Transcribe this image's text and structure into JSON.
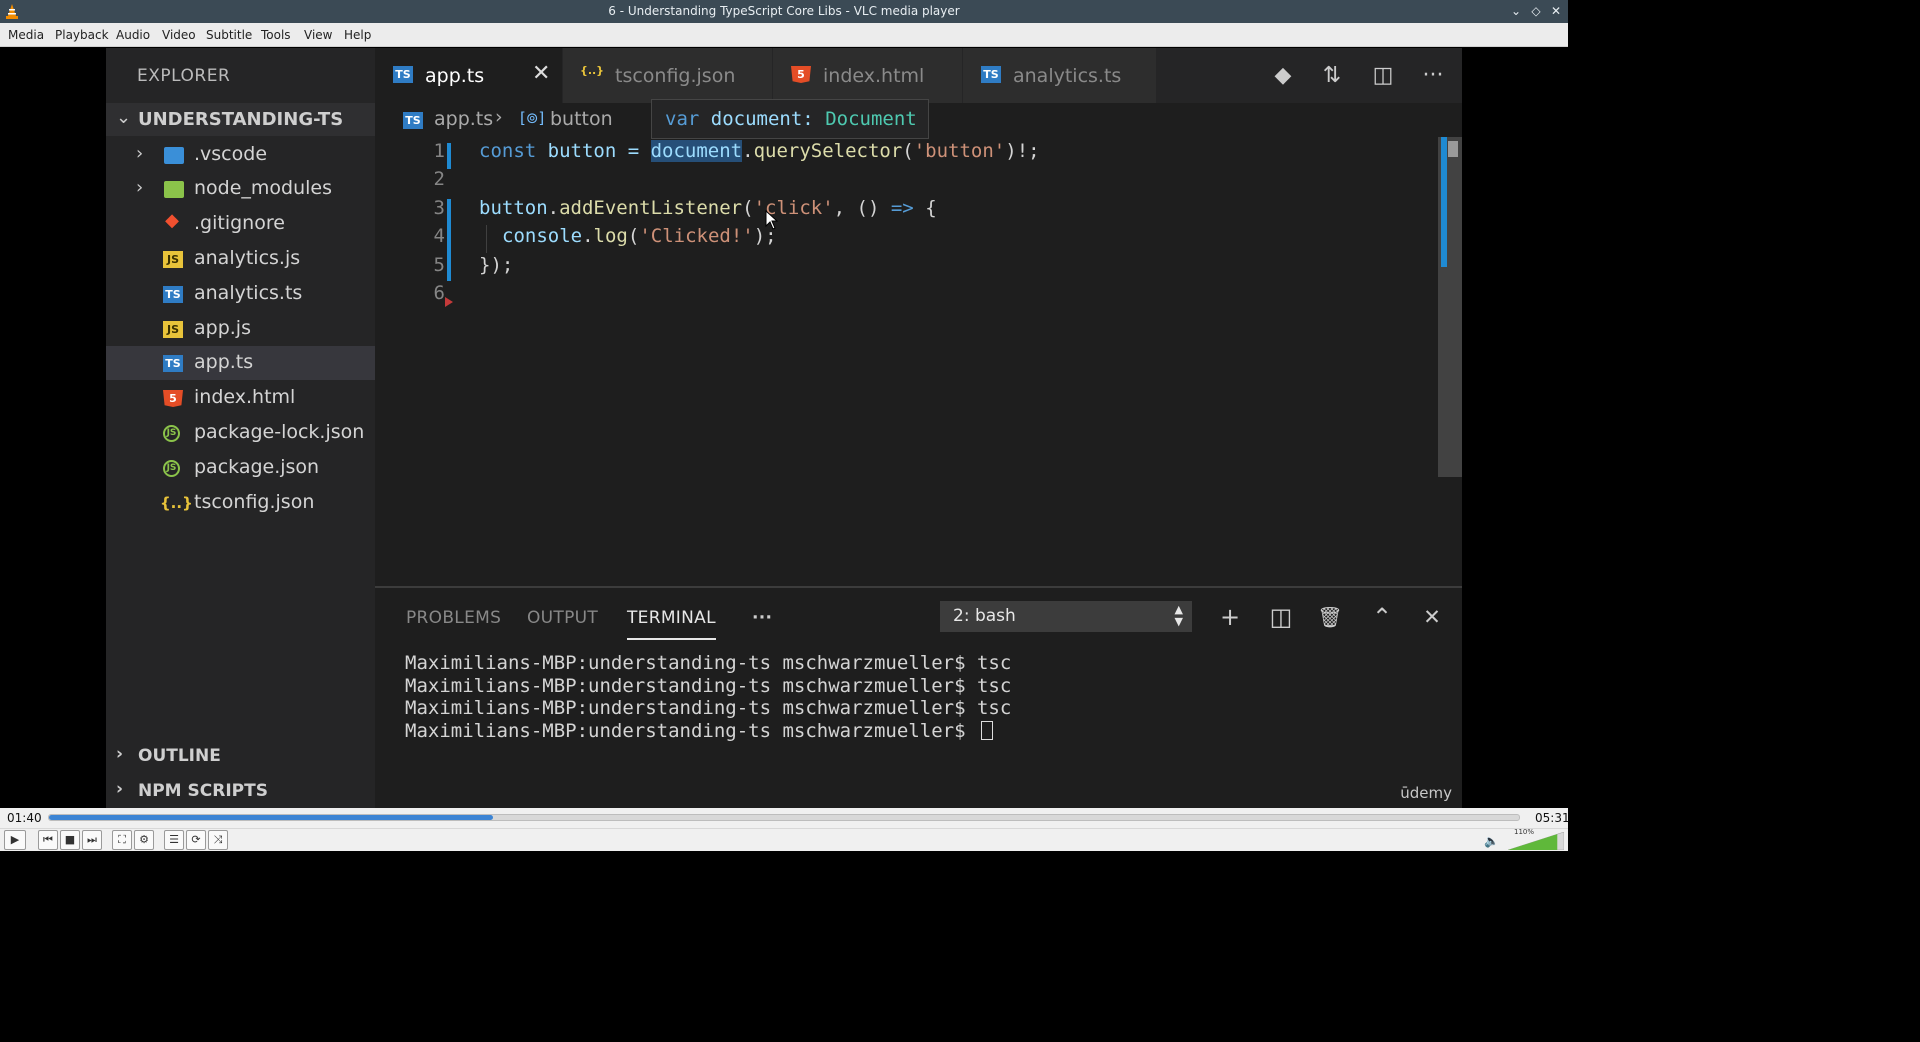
{
  "window": {
    "title": "6 - Understanding TypeScript Core Libs - VLC media player"
  },
  "menubar": [
    "Media",
    "Playback",
    "Audio",
    "Video",
    "Subtitle",
    "Tools",
    "View",
    "Help"
  ],
  "explorer": {
    "header": "EXPLORER",
    "root": "UNDERSTANDING-TS",
    "items": [
      {
        "name": ".vscode",
        "icon": "folder-vscode-icon",
        "folder": true
      },
      {
        "name": "node_modules",
        "icon": "folder-node-icon",
        "folder": true
      },
      {
        "name": ".gitignore",
        "icon": "git-icon"
      },
      {
        "name": "analytics.js",
        "icon": "js-file-icon"
      },
      {
        "name": "analytics.ts",
        "icon": "ts-file-icon"
      },
      {
        "name": "app.js",
        "icon": "js-file-icon"
      },
      {
        "name": "app.ts",
        "icon": "ts-file-icon",
        "selected": true
      },
      {
        "name": "index.html",
        "icon": "html5-file-icon"
      },
      {
        "name": "package-lock.json",
        "icon": "npm-json-icon"
      },
      {
        "name": "package.json",
        "icon": "npm-json-icon"
      },
      {
        "name": "tsconfig.json",
        "icon": "json-braces-icon"
      }
    ],
    "outline": "OUTLINE",
    "npm_scripts": "NPM SCRIPTS"
  },
  "tabs": [
    {
      "label": "app.ts",
      "active": true
    },
    {
      "label": "tsconfig.json"
    },
    {
      "label": "index.html"
    },
    {
      "label": "analytics.ts"
    }
  ],
  "breadcrumb": {
    "file": "app.ts",
    "symbol": "button"
  },
  "hover": {
    "keyword": "var",
    "name": "document:",
    "type": "Document"
  },
  "code": {
    "line_numbers": [
      "1",
      "2",
      "3",
      "4",
      "5",
      "6"
    ],
    "l1": {
      "kw": "const",
      "name": " button = ",
      "doc": "document",
      "rest_pre": ".",
      "fn": "querySelector",
      "p1": "(",
      "str": "'button'",
      "p2": ")!;"
    },
    "l3": {
      "obj": "button",
      "dot": ".",
      "fn": "addEventListener",
      "p1": "(",
      "str": "'click'",
      "p2": ", () ",
      "arrow": "=>",
      "p3": " {"
    },
    "l4": {
      "obj": "console",
      "dot": ".",
      "fn": "log",
      "p1": "(",
      "str": "'Clicked!'",
      "p2": ");"
    },
    "l5": "});"
  },
  "panel": {
    "tabs": [
      "PROBLEMS",
      "OUTPUT",
      "TERMINAL",
      "···"
    ],
    "active_tab": "TERMINAL",
    "shell_select": "2: bash",
    "terminal_lines": [
      "Maximilians-MBP:understanding-ts mschwarzmueller$ tsc",
      "Maximilians-MBP:understanding-ts mschwarzmueller$ tsc",
      "Maximilians-MBP:understanding-ts mschwarzmueller$ tsc",
      "Maximilians-MBP:understanding-ts mschwarzmueller$ "
    ],
    "watermark": "ūdemy"
  },
  "player": {
    "elapsed": "01:40",
    "total": "05:31",
    "progress": 0.302,
    "volume_label": "110%",
    "volume": 1.1
  },
  "colors": {
    "accent": "#1f8ad2",
    "progress": "#3c84d4"
  }
}
